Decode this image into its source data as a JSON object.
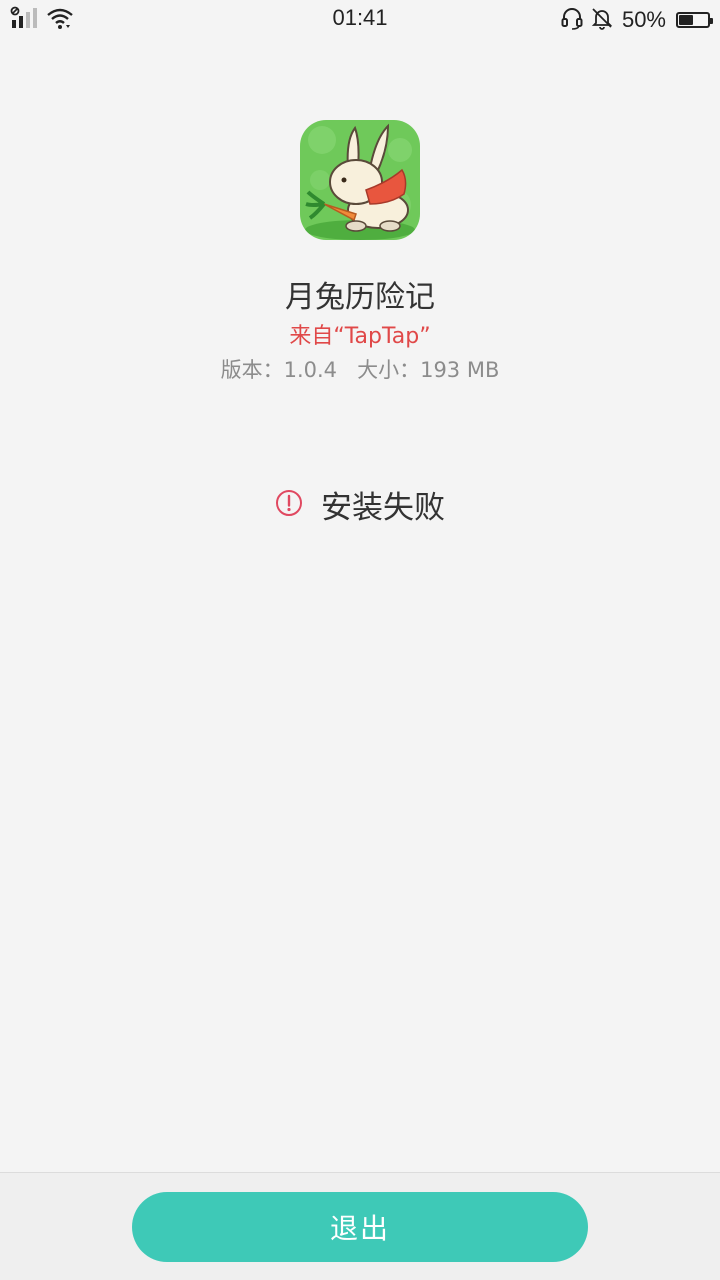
{
  "status_bar": {
    "time": "01:41",
    "battery_percent_label": "50%",
    "battery_level": 0.5,
    "icons": [
      "signal-icon",
      "wifi-icon",
      "headset-icon",
      "mute-bell-icon",
      "battery-icon"
    ]
  },
  "app": {
    "name": "月兔历险记",
    "source": "来自“TapTap”",
    "version_label": "版本：1.0.4",
    "size_label": "大小：193 MB",
    "icon": "moon-rabbit-app-icon"
  },
  "install": {
    "status_text": "安装失败",
    "status_icon": "error-circle-icon",
    "status_color": "#e04848"
  },
  "footer": {
    "exit_label": "退出",
    "accent_color": "#3ec9b7"
  }
}
